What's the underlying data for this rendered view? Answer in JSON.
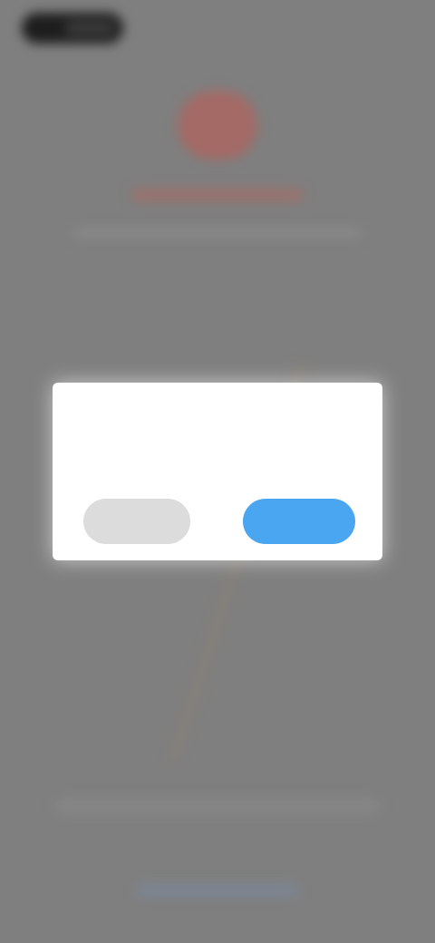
{
  "dialog": {
    "message_line1": "",
    "message_line2": "",
    "cancel_label": "",
    "confirm_label": ""
  },
  "colors": {
    "overlay": "#7f7f7f",
    "logo_accent": "#a46a66",
    "confirm_button": "#4aa6f0",
    "cancel_button": "#dcdcdc",
    "dialog_background": "#ffffff"
  }
}
